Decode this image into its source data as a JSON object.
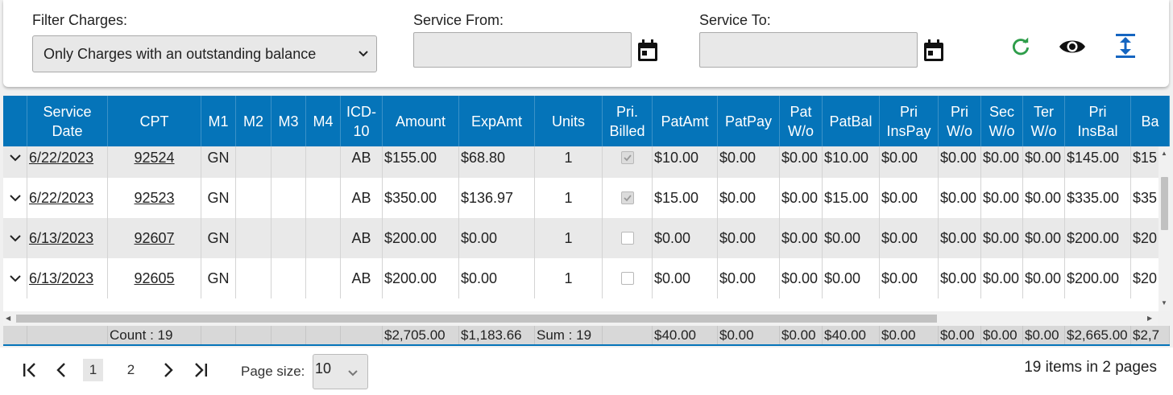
{
  "filters": {
    "filter_label": "Filter Charges:",
    "filter_value": "Only Charges with an outstanding balance",
    "service_from_label": "Service From:",
    "service_from_value": "",
    "service_to_label": "Service To:",
    "service_to_value": ""
  },
  "toolbar_icons": [
    "refresh-icon",
    "eye-icon",
    "expand-vertical-icon"
  ],
  "colors": {
    "header_bg": "#0574b9",
    "refresh_green": "#2e9d4a",
    "expand_blue": "#1565c0"
  },
  "grid": {
    "columns": [
      {
        "key": "expander",
        "label": ""
      },
      {
        "key": "service_date",
        "label": "Service\nDate"
      },
      {
        "key": "cpt",
        "label": "CPT"
      },
      {
        "key": "m1",
        "label": "M1"
      },
      {
        "key": "m2",
        "label": "M2"
      },
      {
        "key": "m3",
        "label": "M3"
      },
      {
        "key": "m4",
        "label": "M4"
      },
      {
        "key": "icd10",
        "label": "ICD-\n10"
      },
      {
        "key": "amount",
        "label": "Amount"
      },
      {
        "key": "expamt",
        "label": "ExpAmt"
      },
      {
        "key": "units",
        "label": "Units"
      },
      {
        "key": "pri_billed",
        "label": "Pri.\nBilled"
      },
      {
        "key": "patamt",
        "label": "PatAmt"
      },
      {
        "key": "patpay",
        "label": "PatPay"
      },
      {
        "key": "pat_wo",
        "label": "Pat\nW/o"
      },
      {
        "key": "patbal",
        "label": "PatBal"
      },
      {
        "key": "pri_inspay",
        "label": "Pri\nInsPay"
      },
      {
        "key": "pri_wo",
        "label": "Pri\nW/o"
      },
      {
        "key": "sec_wo",
        "label": "Sec\nW/o"
      },
      {
        "key": "ter_wo",
        "label": "Ter\nW/o"
      },
      {
        "key": "pri_insbal",
        "label": "Pri\nInsBal"
      },
      {
        "key": "bal",
        "label": "Ba"
      }
    ],
    "rows": [
      {
        "service_date": "6/22/2023",
        "cpt": "92524",
        "m1": "GN",
        "m2": "",
        "m3": "",
        "m4": "",
        "icd10": "AB",
        "amount": "$155.00",
        "expamt": "$68.80",
        "units": "1",
        "pri_billed": true,
        "patamt": "$10.00",
        "patpay": "$0.00",
        "pat_wo": "$0.00",
        "patbal": "$10.00",
        "pri_inspay": "$0.00",
        "pri_wo": "$0.00",
        "sec_wo": "$0.00",
        "ter_wo": "$0.00",
        "pri_insbal": "$145.00",
        "bal": "$15"
      },
      {
        "service_date": "6/22/2023",
        "cpt": "92523",
        "m1": "GN",
        "m2": "",
        "m3": "",
        "m4": "",
        "icd10": "AB",
        "amount": "$350.00",
        "expamt": "$136.97",
        "units": "1",
        "pri_billed": true,
        "patamt": "$15.00",
        "patpay": "$0.00",
        "pat_wo": "$0.00",
        "patbal": "$15.00",
        "pri_inspay": "$0.00",
        "pri_wo": "$0.00",
        "sec_wo": "$0.00",
        "ter_wo": "$0.00",
        "pri_insbal": "$335.00",
        "bal": "$35"
      },
      {
        "service_date": "6/13/2023",
        "cpt": "92607",
        "m1": "GN",
        "m2": "",
        "m3": "",
        "m4": "",
        "icd10": "AB",
        "amount": "$200.00",
        "expamt": "$0.00",
        "units": "1",
        "pri_billed": false,
        "patamt": "$0.00",
        "patpay": "$0.00",
        "pat_wo": "$0.00",
        "patbal": "$0.00",
        "pri_inspay": "$0.00",
        "pri_wo": "$0.00",
        "sec_wo": "$0.00",
        "ter_wo": "$0.00",
        "pri_insbal": "$200.00",
        "bal": "$20"
      },
      {
        "service_date": "6/13/2023",
        "cpt": "92605",
        "m1": "GN",
        "m2": "",
        "m3": "",
        "m4": "",
        "icd10": "AB",
        "amount": "$200.00",
        "expamt": "$0.00",
        "units": "1",
        "pri_billed": false,
        "patamt": "$0.00",
        "patpay": "$0.00",
        "pat_wo": "$0.00",
        "patbal": "$0.00",
        "pri_inspay": "$0.00",
        "pri_wo": "$0.00",
        "sec_wo": "$0.00",
        "ter_wo": "$0.00",
        "pri_insbal": "$200.00",
        "bal": "$20"
      }
    ],
    "footer": {
      "cpt": "Count : 19",
      "amount": "$2,705.00",
      "expamt": "$1,183.66",
      "units": "Sum : 19",
      "patamt": "$40.00",
      "patpay": "$0.00",
      "pat_wo": "$0.00",
      "patbal": "$40.00",
      "pri_inspay": "$0.00",
      "pri_wo": "$0.00",
      "sec_wo": "$0.00",
      "ter_wo": "$0.00",
      "pri_insbal": "$2,665.00",
      "bal": "$2,7"
    }
  },
  "pager": {
    "pages": [
      "1",
      "2"
    ],
    "current_page": "1",
    "page_size_label": "Page size:",
    "page_size_value": "10",
    "items_info": "19 items in 2 pages"
  }
}
